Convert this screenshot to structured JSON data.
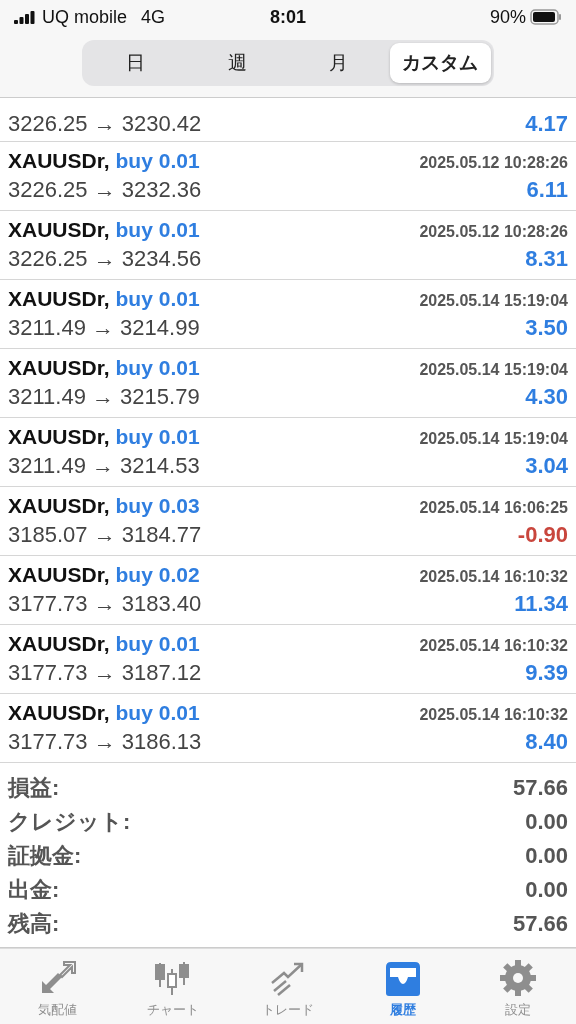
{
  "status_bar": {
    "carrier": "UQ mobile",
    "network": "4G",
    "time": "8:01",
    "battery": "90%"
  },
  "period_tabs": [
    {
      "label": "日",
      "selected": false
    },
    {
      "label": "週",
      "selected": false
    },
    {
      "label": "月",
      "selected": false
    },
    {
      "label": "カスタム",
      "selected": true
    }
  ],
  "partial_deal": {
    "prices": "3226.25 → 3230.42",
    "profit": "4.17",
    "color": "#2f7ee0"
  },
  "deals": [
    {
      "symbol": "XAUUSDr,",
      "side": "buy 0.01",
      "time": "2025.05.12 10:28:26",
      "prices": "3226.25 → 3232.36",
      "profit": "6.11",
      "color": "#2f7ee0"
    },
    {
      "symbol": "XAUUSDr,",
      "side": "buy 0.01",
      "time": "2025.05.12 10:28:26",
      "prices": "3226.25 → 3234.56",
      "profit": "8.31",
      "color": "#2f7ee0"
    },
    {
      "symbol": "XAUUSDr,",
      "side": "buy 0.01",
      "time": "2025.05.14 15:19:04",
      "prices": "3211.49 → 3214.99",
      "profit": "3.50",
      "color": "#2f7ee0"
    },
    {
      "symbol": "XAUUSDr,",
      "side": "buy 0.01",
      "time": "2025.05.14 15:19:04",
      "prices": "3211.49 → 3215.79",
      "profit": "4.30",
      "color": "#2f7ee0"
    },
    {
      "symbol": "XAUUSDr,",
      "side": "buy 0.01",
      "time": "2025.05.14 15:19:04",
      "prices": "3211.49 → 3214.53",
      "profit": "3.04",
      "color": "#2f7ee0"
    },
    {
      "symbol": "XAUUSDr,",
      "side": "buy 0.03",
      "time": "2025.05.14 16:06:25",
      "prices": "3185.07 → 3184.77",
      "profit": "-0.90",
      "color": "#c9463d"
    },
    {
      "symbol": "XAUUSDr,",
      "side": "buy 0.02",
      "time": "2025.05.14 16:10:32",
      "prices": "3177.73 → 3183.40",
      "profit": "11.34",
      "color": "#2f7ee0"
    },
    {
      "symbol": "XAUUSDr,",
      "side": "buy 0.01",
      "time": "2025.05.14 16:10:32",
      "prices": "3177.73 → 3187.12",
      "profit": "9.39",
      "color": "#2f7ee0"
    },
    {
      "symbol": "XAUUSDr,",
      "side": "buy 0.01",
      "time": "2025.05.14 16:10:32",
      "prices": "3177.73 → 3186.13",
      "profit": "8.40",
      "color": "#2f7ee0"
    }
  ],
  "summary": [
    {
      "label": "損益:",
      "value": "57.66"
    },
    {
      "label": "クレジット:",
      "value": "0.00"
    },
    {
      "label": "証拠金:",
      "value": "0.00"
    },
    {
      "label": "出金:",
      "value": "0.00"
    },
    {
      "label": "残高:",
      "value": "57.66"
    }
  ],
  "tab_bar": [
    {
      "kind": "quotes",
      "label": "気配値",
      "selected": false
    },
    {
      "kind": "chart",
      "label": "チャート",
      "selected": false
    },
    {
      "kind": "trade",
      "label": "トレード",
      "selected": false
    },
    {
      "kind": "history",
      "label": "履歴",
      "selected": true
    },
    {
      "kind": "settings",
      "label": "設定",
      "selected": false
    }
  ]
}
